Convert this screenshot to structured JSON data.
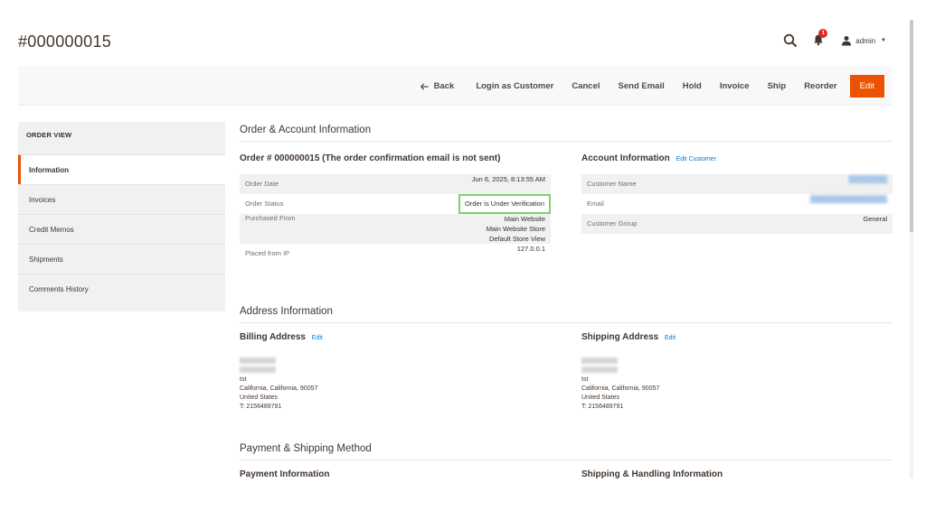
{
  "page": {
    "title": "#000000015"
  },
  "header": {
    "notifications_count": "1",
    "user": "admin"
  },
  "toolbar": {
    "back": "Back",
    "login_as_customer": "Login as Customer",
    "cancel": "Cancel",
    "send_email": "Send Email",
    "hold": "Hold",
    "invoice": "Invoice",
    "ship": "Ship",
    "reorder": "Reorder",
    "edit": "Edit"
  },
  "sidebar": {
    "title": "ORDER VIEW",
    "items": [
      "Information",
      "Invoices",
      "Credit Memos",
      "Shipments",
      "Comments History"
    ]
  },
  "order_account": {
    "section_title": "Order & Account Information",
    "order_heading": "Order # 000000015 (The order confirmation email is not sent)",
    "order_date_label": "Order Date",
    "order_date": "Jun 6, 2025, 8:13:55 AM",
    "order_status_label": "Order Status",
    "order_status": "Order is Under Verification",
    "purchased_from_label": "Purchased From",
    "purchased_from": [
      "Main Website",
      "Main Website Store",
      "Default Store View"
    ],
    "placed_from_ip_label": "Placed from IP",
    "placed_from_ip": "127.0.0.1",
    "account_heading": "Account Information",
    "edit_customer": "Edit Customer",
    "customer_name_label": "Customer Name",
    "email_label": "Email",
    "customer_group_label": "Customer Group",
    "customer_group": "General"
  },
  "address": {
    "section_title": "Address Information",
    "billing_title": "Billing Address",
    "shipping_title": "Shipping Address",
    "edit": "Edit",
    "lines": [
      "tst",
      "California, California, 90057",
      "United States",
      "T: 2156489791"
    ]
  },
  "payment": {
    "section_title": "Payment & Shipping Method",
    "payment_info": "Payment Information",
    "shipping_info": "Shipping & Handling Information"
  }
}
